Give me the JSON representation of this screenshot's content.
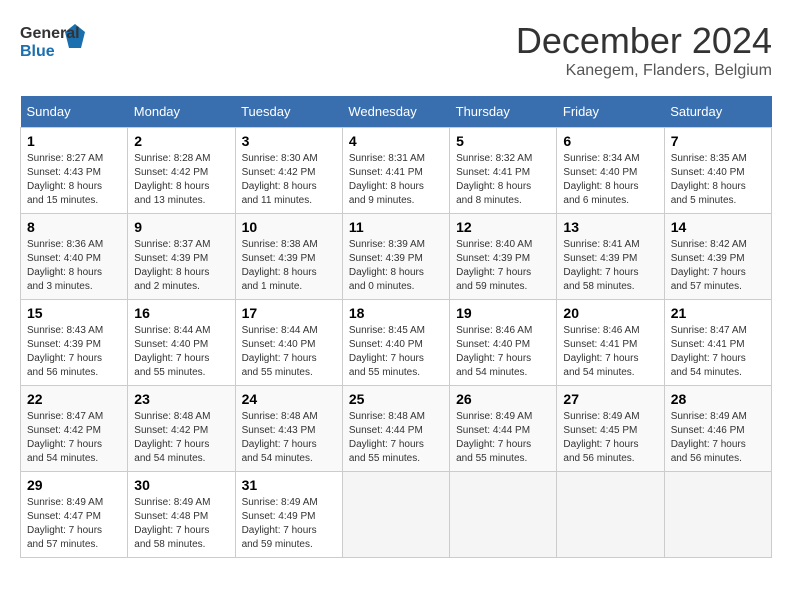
{
  "logo": {
    "line1": "General",
    "line2": "Blue"
  },
  "title": "December 2024",
  "location": "Kanegem, Flanders, Belgium",
  "days_of_week": [
    "Sunday",
    "Monday",
    "Tuesday",
    "Wednesday",
    "Thursday",
    "Friday",
    "Saturday"
  ],
  "weeks": [
    [
      {
        "day": "1",
        "info": "Sunrise: 8:27 AM\nSunset: 4:43 PM\nDaylight: 8 hours\nand 15 minutes."
      },
      {
        "day": "2",
        "info": "Sunrise: 8:28 AM\nSunset: 4:42 PM\nDaylight: 8 hours\nand 13 minutes."
      },
      {
        "day": "3",
        "info": "Sunrise: 8:30 AM\nSunset: 4:42 PM\nDaylight: 8 hours\nand 11 minutes."
      },
      {
        "day": "4",
        "info": "Sunrise: 8:31 AM\nSunset: 4:41 PM\nDaylight: 8 hours\nand 9 minutes."
      },
      {
        "day": "5",
        "info": "Sunrise: 8:32 AM\nSunset: 4:41 PM\nDaylight: 8 hours\nand 8 minutes."
      },
      {
        "day": "6",
        "info": "Sunrise: 8:34 AM\nSunset: 4:40 PM\nDaylight: 8 hours\nand 6 minutes."
      },
      {
        "day": "7",
        "info": "Sunrise: 8:35 AM\nSunset: 4:40 PM\nDaylight: 8 hours\nand 5 minutes."
      }
    ],
    [
      {
        "day": "8",
        "info": "Sunrise: 8:36 AM\nSunset: 4:40 PM\nDaylight: 8 hours\nand 3 minutes."
      },
      {
        "day": "9",
        "info": "Sunrise: 8:37 AM\nSunset: 4:39 PM\nDaylight: 8 hours\nand 2 minutes."
      },
      {
        "day": "10",
        "info": "Sunrise: 8:38 AM\nSunset: 4:39 PM\nDaylight: 8 hours\nand 1 minute."
      },
      {
        "day": "11",
        "info": "Sunrise: 8:39 AM\nSunset: 4:39 PM\nDaylight: 8 hours\nand 0 minutes."
      },
      {
        "day": "12",
        "info": "Sunrise: 8:40 AM\nSunset: 4:39 PM\nDaylight: 7 hours\nand 59 minutes."
      },
      {
        "day": "13",
        "info": "Sunrise: 8:41 AM\nSunset: 4:39 PM\nDaylight: 7 hours\nand 58 minutes."
      },
      {
        "day": "14",
        "info": "Sunrise: 8:42 AM\nSunset: 4:39 PM\nDaylight: 7 hours\nand 57 minutes."
      }
    ],
    [
      {
        "day": "15",
        "info": "Sunrise: 8:43 AM\nSunset: 4:39 PM\nDaylight: 7 hours\nand 56 minutes."
      },
      {
        "day": "16",
        "info": "Sunrise: 8:44 AM\nSunset: 4:40 PM\nDaylight: 7 hours\nand 55 minutes."
      },
      {
        "day": "17",
        "info": "Sunrise: 8:44 AM\nSunset: 4:40 PM\nDaylight: 7 hours\nand 55 minutes."
      },
      {
        "day": "18",
        "info": "Sunrise: 8:45 AM\nSunset: 4:40 PM\nDaylight: 7 hours\nand 55 minutes."
      },
      {
        "day": "19",
        "info": "Sunrise: 8:46 AM\nSunset: 4:40 PM\nDaylight: 7 hours\nand 54 minutes."
      },
      {
        "day": "20",
        "info": "Sunrise: 8:46 AM\nSunset: 4:41 PM\nDaylight: 7 hours\nand 54 minutes."
      },
      {
        "day": "21",
        "info": "Sunrise: 8:47 AM\nSunset: 4:41 PM\nDaylight: 7 hours\nand 54 minutes."
      }
    ],
    [
      {
        "day": "22",
        "info": "Sunrise: 8:47 AM\nSunset: 4:42 PM\nDaylight: 7 hours\nand 54 minutes."
      },
      {
        "day": "23",
        "info": "Sunrise: 8:48 AM\nSunset: 4:42 PM\nDaylight: 7 hours\nand 54 minutes."
      },
      {
        "day": "24",
        "info": "Sunrise: 8:48 AM\nSunset: 4:43 PM\nDaylight: 7 hours\nand 54 minutes."
      },
      {
        "day": "25",
        "info": "Sunrise: 8:48 AM\nSunset: 4:44 PM\nDaylight: 7 hours\nand 55 minutes."
      },
      {
        "day": "26",
        "info": "Sunrise: 8:49 AM\nSunset: 4:44 PM\nDaylight: 7 hours\nand 55 minutes."
      },
      {
        "day": "27",
        "info": "Sunrise: 8:49 AM\nSunset: 4:45 PM\nDaylight: 7 hours\nand 56 minutes."
      },
      {
        "day": "28",
        "info": "Sunrise: 8:49 AM\nSunset: 4:46 PM\nDaylight: 7 hours\nand 56 minutes."
      }
    ],
    [
      {
        "day": "29",
        "info": "Sunrise: 8:49 AM\nSunset: 4:47 PM\nDaylight: 7 hours\nand 57 minutes."
      },
      {
        "day": "30",
        "info": "Sunrise: 8:49 AM\nSunset: 4:48 PM\nDaylight: 7 hours\nand 58 minutes."
      },
      {
        "day": "31",
        "info": "Sunrise: 8:49 AM\nSunset: 4:49 PM\nDaylight: 7 hours\nand 59 minutes."
      },
      {
        "day": "",
        "info": ""
      },
      {
        "day": "",
        "info": ""
      },
      {
        "day": "",
        "info": ""
      },
      {
        "day": "",
        "info": ""
      }
    ]
  ]
}
